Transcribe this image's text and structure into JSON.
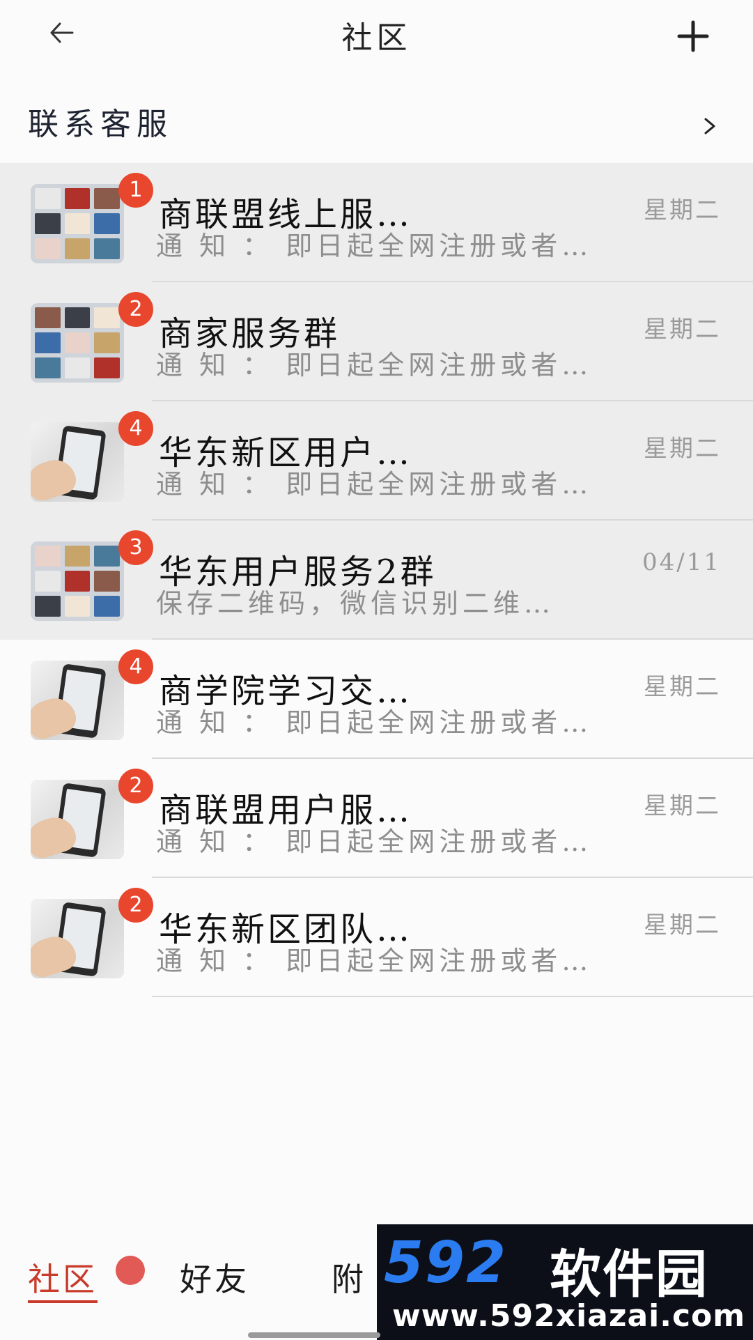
{
  "header": {
    "title": "社区"
  },
  "contact": {
    "label": "联系客服"
  },
  "chats": [
    {
      "name": "商联盟线上服…",
      "time": "星期二",
      "preview": "通 知 ：  即日起全网注册或者…",
      "badge": "1",
      "avatar": "grid",
      "shaded": true
    },
    {
      "name": "商家服务群",
      "time": "星期二",
      "preview": "通 知 ：  即日起全网注册或者…",
      "badge": "2",
      "avatar": "grid",
      "shaded": true
    },
    {
      "name": "华东新区用户…",
      "time": "星期二",
      "preview": "通 知 ：  即日起全网注册或者…",
      "badge": "4",
      "avatar": "phone",
      "shaded": true
    },
    {
      "name": "华东用户服务2群",
      "time": "04/11",
      "preview": "保存二维码，微信识别二维…",
      "badge": "3",
      "avatar": "grid",
      "shaded": true
    },
    {
      "name": "商学院学习交…",
      "time": "星期二",
      "preview": "通 知 ：  即日起全网注册或者…",
      "badge": "4",
      "avatar": "phone",
      "shaded": false
    },
    {
      "name": "商联盟用户服…",
      "time": "星期二",
      "preview": "通 知 ：  即日起全网注册或者…",
      "badge": "2",
      "avatar": "phone",
      "shaded": false
    },
    {
      "name": "华东新区团队…",
      "time": "星期二",
      "preview": "通 知 ：  即日起全网注册或者…",
      "badge": "2",
      "avatar": "phone",
      "shaded": false
    }
  ],
  "tabs": [
    {
      "label": "社区",
      "active": true
    },
    {
      "label": "好友",
      "active": false
    },
    {
      "label": "附",
      "active": false
    }
  ],
  "watermark": {
    "brand_num": "592",
    "brand_cn": "软件园",
    "url": "www.592xiazai.com"
  },
  "colors": {
    "accent": "#c83a2a",
    "badge": "#e8472e",
    "watermark_blue": "#2b7cf0"
  }
}
